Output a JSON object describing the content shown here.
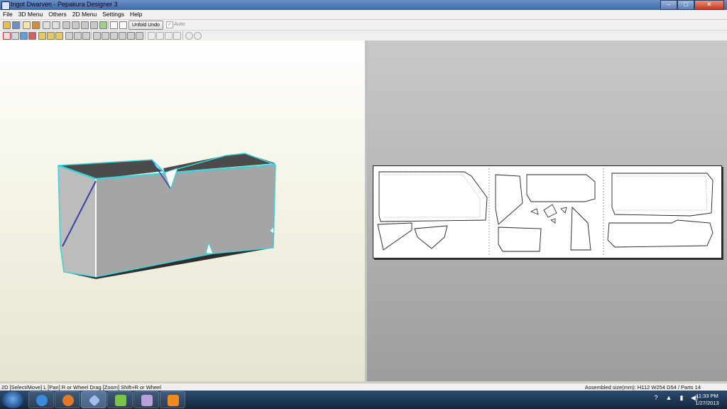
{
  "window": {
    "title": "Ingot Dwarven - Pepakura Designer 3",
    "buttons": {
      "minimize": "–",
      "maximize": "□",
      "close": "✕"
    }
  },
  "menu": [
    "File",
    "3D Menu",
    "Others",
    "2D Menu",
    "Settings",
    "Help"
  ],
  "toolbar": {
    "unfold_undo": "Unfold Undo",
    "auto": "Auto",
    "auto_checked": "✓"
  },
  "status": {
    "left": "2D [Select/Move] L [Pan] R or Wheel Drag [Zoom] Shift+R or Wheel",
    "right": "Assembled size(mm): H112 W254 D54 / Parts 14"
  },
  "taskbar": {
    "apps": [
      "internet-explorer",
      "blender",
      "pepakura",
      "notepad-plus-plus",
      "media-app",
      "photo-app"
    ],
    "tray": [
      "?",
      "▲",
      "▮",
      "◀)"
    ],
    "time": "11:33 PM",
    "date": "1/27/2013"
  },
  "colors": {
    "model_face": "#a5a5a5",
    "model_top": "#4b4b4b",
    "edge_highlight": "#39d3d8",
    "paper": "#ffffff"
  }
}
